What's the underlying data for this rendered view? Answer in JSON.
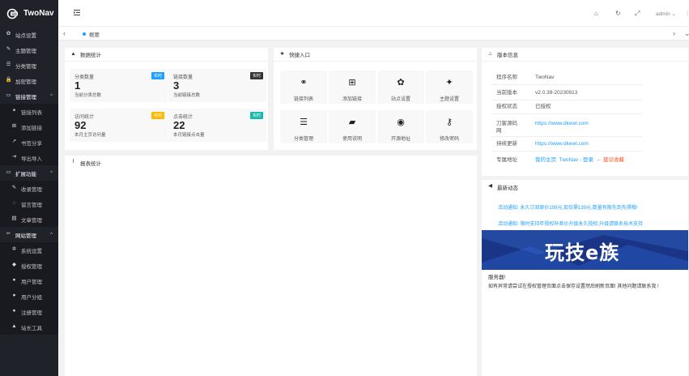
{
  "app": {
    "title": "TwoNav",
    "user": "admin"
  },
  "sidebar": {
    "items": [
      {
        "label": "站点设置",
        "icon": "gear-icon",
        "glyph": "✿",
        "type": "top"
      },
      {
        "label": "主题管理",
        "icon": "brush-icon",
        "glyph": "✎",
        "type": "top"
      },
      {
        "label": "分类管理",
        "icon": "list-icon",
        "glyph": "☰",
        "type": "top"
      },
      {
        "label": "加密管理",
        "icon": "lock-icon",
        "glyph": "🔒",
        "type": "top"
      },
      {
        "label": "链接管理",
        "icon": "folder-icon",
        "glyph": "▭",
        "type": "group",
        "caret": "^"
      },
      {
        "label": "链接列表",
        "icon": "link-icon",
        "glyph": "⚭",
        "type": "sub"
      },
      {
        "label": "添加链接",
        "icon": "plus-square-icon",
        "glyph": "⊞",
        "type": "sub"
      },
      {
        "label": "书签分享",
        "icon": "share-icon",
        "glyph": "↗",
        "type": "sub"
      },
      {
        "label": "导出导入",
        "icon": "import-icon",
        "glyph": "⇥",
        "type": "sub"
      },
      {
        "label": "扩展功能",
        "icon": "folder-icon",
        "glyph": "▭",
        "type": "group",
        "caret": "^"
      },
      {
        "label": "收录管理",
        "icon": "pencil-icon",
        "glyph": "✎",
        "type": "sub"
      },
      {
        "label": "留言管理",
        "icon": "chat-icon",
        "glyph": "◌",
        "type": "sub"
      },
      {
        "label": "文章管理",
        "icon": "article-icon",
        "glyph": "▤",
        "type": "sub"
      },
      {
        "label": "网站管理",
        "icon": "wrench-icon",
        "glyph": "✂",
        "type": "group",
        "caret": "^"
      },
      {
        "label": "系统设置",
        "icon": "cogs-icon",
        "glyph": "✲",
        "type": "sub"
      },
      {
        "label": "授权管理",
        "icon": "diamond-icon",
        "glyph": "◆",
        "type": "sub"
      },
      {
        "label": "用户管理",
        "icon": "user-icon",
        "glyph": "●",
        "type": "sub"
      },
      {
        "label": "用户分组",
        "icon": "users-icon",
        "glyph": "●",
        "type": "sub"
      },
      {
        "label": "注册管理",
        "icon": "user-plus-icon",
        "glyph": "●",
        "type": "sub"
      },
      {
        "label": "站长工具",
        "icon": "warning-icon",
        "glyph": "▲",
        "type": "sub"
      }
    ]
  },
  "tabs": {
    "current": "概要"
  },
  "stats": {
    "title": "数据统计",
    "items": [
      {
        "label": "分类数量",
        "badge": "实时",
        "badge_color": "#1e9fff",
        "value": "1",
        "desc": "当前分类总数"
      },
      {
        "label": "链接数量",
        "badge": "实时",
        "badge_color": "#333333",
        "value": "3",
        "desc": "当前链接总数"
      },
      {
        "label": "访问统计",
        "badge": "实时",
        "badge_color": "#ffb800",
        "value": "92",
        "desc": "本月主页访问量"
      },
      {
        "label": "点击统计",
        "badge": "实时",
        "badge_color": "#16baaa",
        "value": "22",
        "desc": "本月链接点击量"
      }
    ]
  },
  "quick": {
    "title": "快捷入口",
    "items": [
      {
        "label": "链接列表",
        "icon": "link-icon",
        "glyph": "⚭"
      },
      {
        "label": "添加链接",
        "icon": "plus-square-icon",
        "glyph": "⊞"
      },
      {
        "label": "站点设置",
        "icon": "gear-icon",
        "glyph": "✿"
      },
      {
        "label": "主题设置",
        "icon": "magic-wand-icon",
        "glyph": "✦"
      },
      {
        "label": "分类管理",
        "icon": "list-icon",
        "glyph": "☰"
      },
      {
        "label": "使用说明",
        "icon": "book-icon",
        "glyph": "▰"
      },
      {
        "label": "开源地址",
        "icon": "github-icon",
        "glyph": "◉"
      },
      {
        "label": "修改密码",
        "icon": "key-icon",
        "glyph": "⚷"
      }
    ]
  },
  "report": {
    "title": "报表统计"
  },
  "version": {
    "title": "版本信息",
    "rows": [
      {
        "k": "程序名称",
        "v": "TwoNav"
      },
      {
        "k": "当前版本",
        "v": "v2.0.39-20230913"
      },
      {
        "k": "授权状态",
        "v": "已授权"
      },
      {
        "k": "刀客源码网",
        "v": "https://www.dkewl.com"
      },
      {
        "k": "持续更新",
        "v": "https://www.dkewl.com"
      }
    ],
    "links_label": "专属地址",
    "links": {
      "home": "我的主页",
      "login": "TwoNav - 登录",
      "fav": "建议收藏"
    }
  },
  "news": {
    "title": "最新动态",
    "items": [
      "活动通知: 永久订阅原价199元,现仅需139元,数量有限先到先得哦!",
      "活动通知: 限时支持年授权补差价升级永久授权,升级请联系技术支持"
    ],
    "banner_text": "玩技e族",
    "server_title": "服务器!",
    "server_note": "如有异常请尝试在授权管理页面点击保存设置然后刷新页面! 其他问题请联系我 !"
  },
  "colors": {
    "sidebar": "#20222a",
    "accent": "#1e9fff",
    "fav": "#ff5722"
  }
}
